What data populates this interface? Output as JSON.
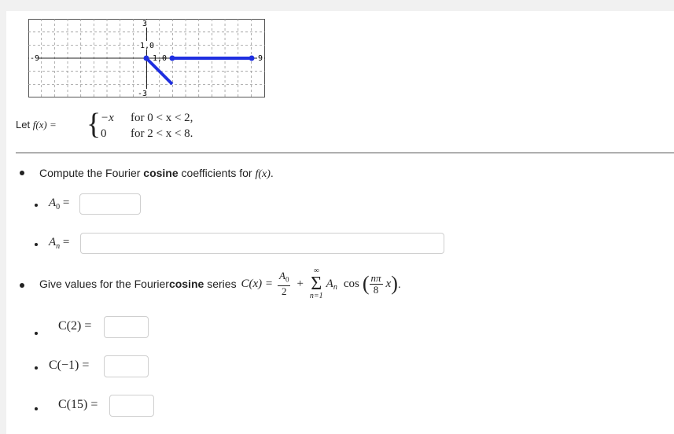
{
  "graph": {
    "x_min_label": "-9",
    "x_max_label": "9",
    "y_max_label": "3",
    "y_min_label": "-3",
    "point_label_1": "1,0",
    "point_label_2": "1,0"
  },
  "function": {
    "let_label": "Let",
    "name": "f(x) =",
    "case1_expr": "−x",
    "case1_cond": "for  0 < x < 2,",
    "case2_expr": "0",
    "case2_cond": "for  2 < x < 8."
  },
  "q1": {
    "text_before": "Compute the Fourier ",
    "text_bold": "cosine",
    "text_after": " coefficients for ",
    "fx": "f(x)",
    "period": ".",
    "a0_label": "A",
    "a0_sub": "0",
    "an_label": "A",
    "an_sub": "n",
    "eq": "=",
    "a0_value": "",
    "an_value": ""
  },
  "q2": {
    "text_before": "Give values for the Fourier ",
    "text_bold": "cosine",
    "text_after": " series ",
    "cx": "C(x) =",
    "frac_num": "A",
    "frac_num_sub": "0",
    "frac_den": "2",
    "plus": "+",
    "sum_top": "∞",
    "sum_sym": "Σ",
    "sum_bot": "n=1",
    "an": "A",
    "an_sub": "n",
    "cos": "cos",
    "arg_num": "nπ",
    "arg_den": "8",
    "arg_x": "x",
    "period": ".",
    "c2_label": "C(2) =",
    "cm1_label": "C(−1) =",
    "c15_label": "C(15) =",
    "c2_value": "",
    "cm1_value": "",
    "c15_value": ""
  },
  "colors": {
    "curve": "#1f2fe0",
    "grid": "#9a9a9a"
  }
}
